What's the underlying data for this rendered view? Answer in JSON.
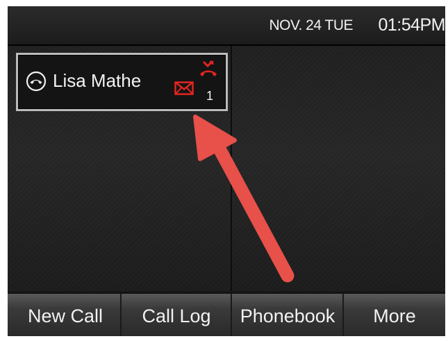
{
  "status_bar": {
    "date": "NOV. 24 TUE",
    "time": "01:54PM"
  },
  "line_key": {
    "name": "Lisa Mathe",
    "status_icon": "phone-handset-circle-icon",
    "voicemail_icon": "envelope-icon",
    "missed_call_icon": "missed-call-icon",
    "missed_count": "1"
  },
  "softkeys": [
    {
      "label": "New Call"
    },
    {
      "label": "Call Log"
    },
    {
      "label": "Phonebook"
    },
    {
      "label": "More"
    }
  ],
  "colors": {
    "alert_red": "#e32420",
    "annotation_arrow": "#e8504a"
  }
}
